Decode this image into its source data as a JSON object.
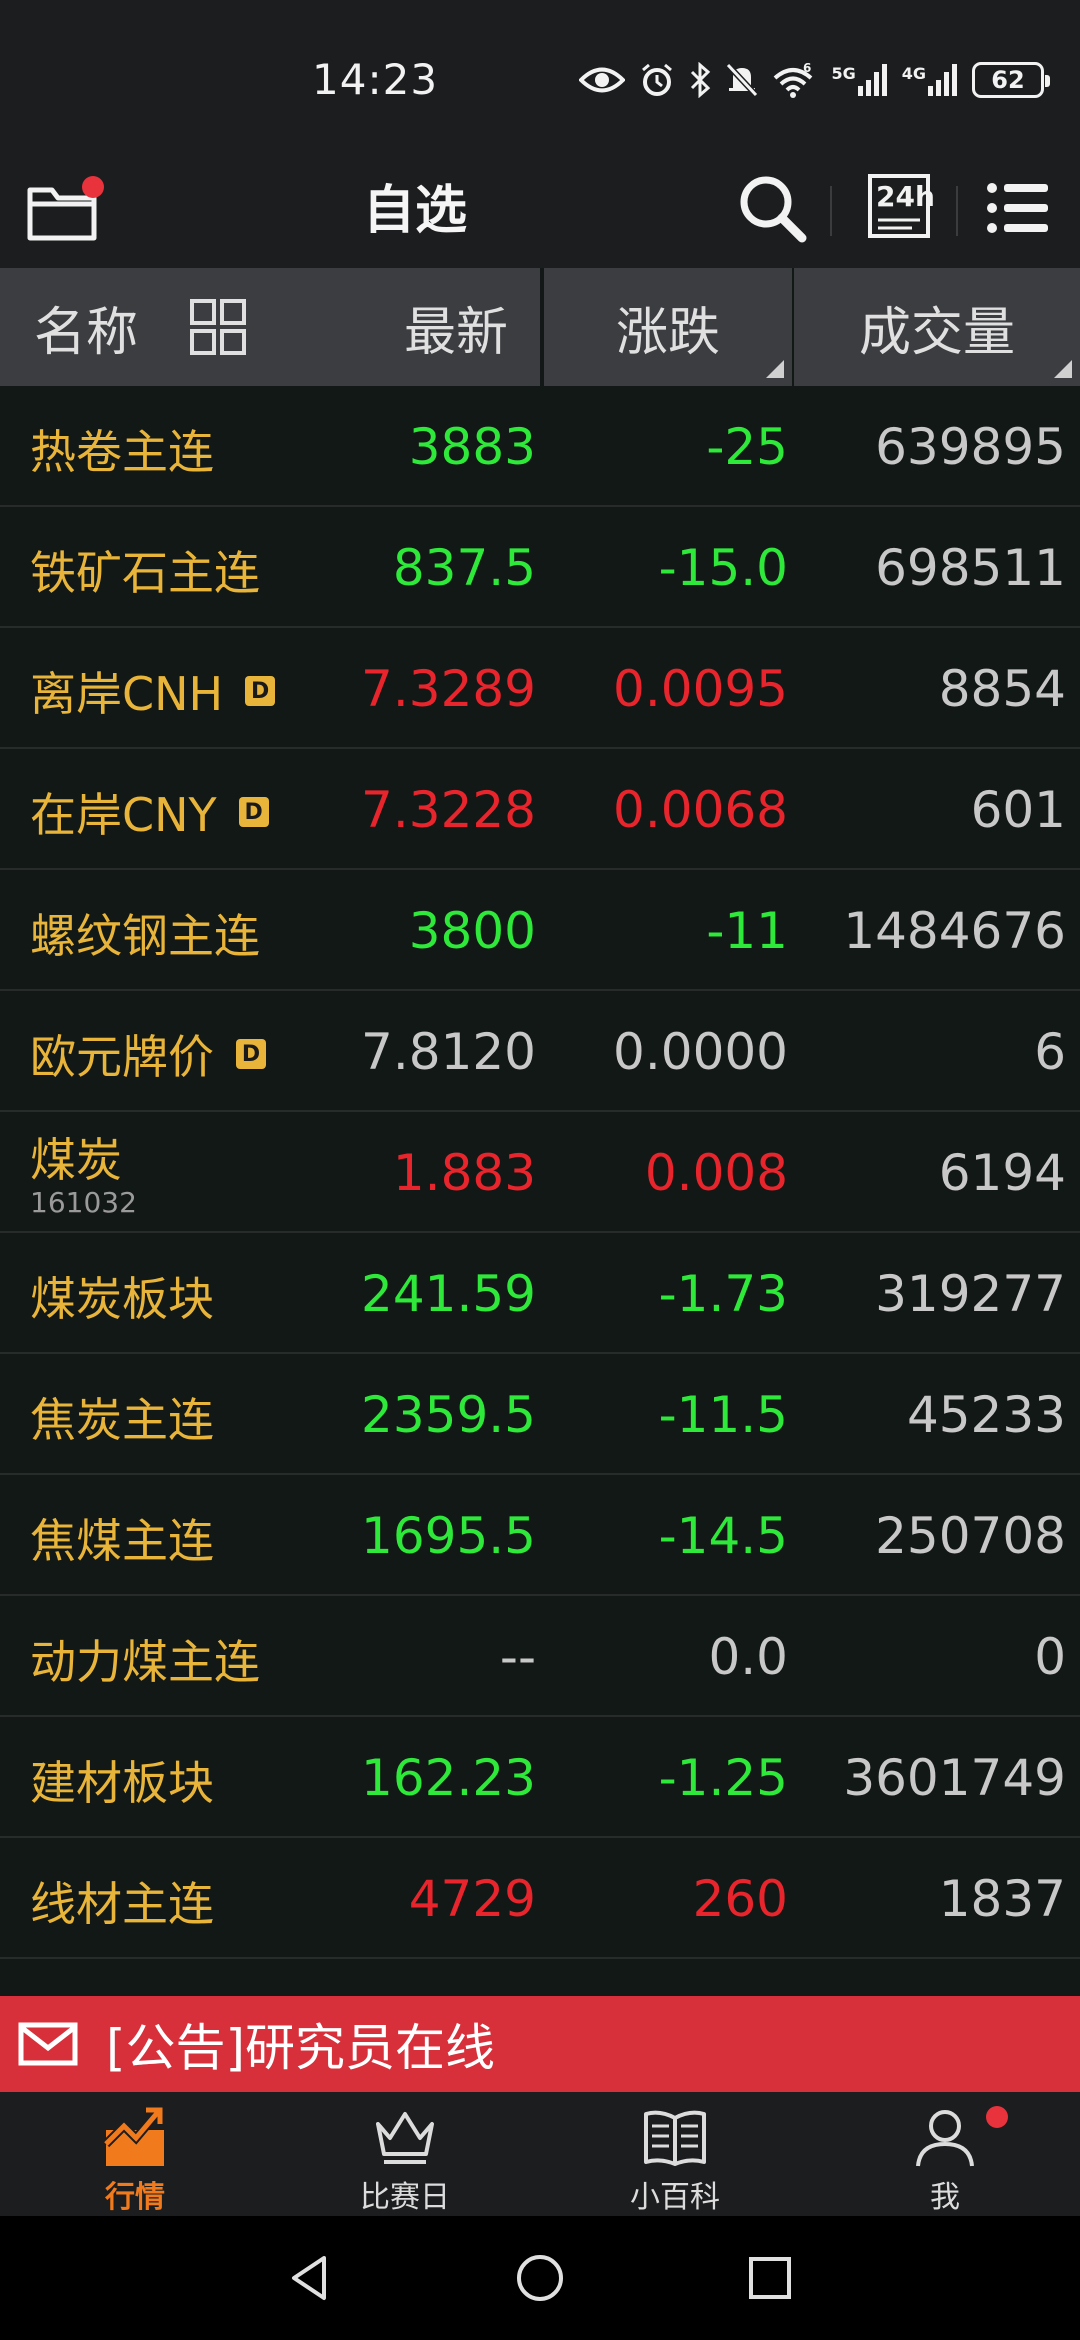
{
  "status_bar": {
    "time": "14:23",
    "signal_5g": "5G",
    "signal_4g": "4G",
    "battery": "62",
    "icons": [
      "eye-icon",
      "alarm-icon",
      "bluetooth-icon",
      "mute-icon",
      "wifi-icon",
      "signal-icon",
      "battery-icon"
    ]
  },
  "app_bar": {
    "title": "自选",
    "h24_label": "24h",
    "icons": [
      "folder-icon",
      "search-icon",
      "24h-icon",
      "list-menu-icon"
    ]
  },
  "columns": {
    "name": "名称",
    "latest": "最新",
    "change": "涨跌",
    "volume": "成交量"
  },
  "rows": [
    {
      "name": "热卷主连",
      "latest": "3883",
      "change": "-25",
      "volume": "639895",
      "color": "green"
    },
    {
      "name": "铁矿石主连",
      "latest": "837.5",
      "change": "-15.0",
      "volume": "698511",
      "color": "green"
    },
    {
      "name": "离岸CNH",
      "badge": "D",
      "latest": "7.3289",
      "change": "0.0095",
      "volume": "8854",
      "color": "red"
    },
    {
      "name": "在岸CNY",
      "badge": "D",
      "latest": "7.3228",
      "change": "0.0068",
      "volume": "601",
      "color": "red"
    },
    {
      "name": "螺纹钢主连",
      "latest": "3800",
      "change": "-11",
      "volume": "1484676",
      "color": "green"
    },
    {
      "name": "欧元牌价",
      "badge": "D",
      "latest": "7.8120",
      "change": "0.0000",
      "volume": "6",
      "color": "gray"
    },
    {
      "name": "煤炭",
      "code": "161032",
      "latest": "1.883",
      "change": "0.008",
      "volume": "6194",
      "color": "red"
    },
    {
      "name": "煤炭板块",
      "latest": "241.59",
      "change": "-1.73",
      "volume": "319277",
      "color": "green"
    },
    {
      "name": "焦炭主连",
      "latest": "2359.5",
      "change": "-11.5",
      "volume": "45233",
      "color": "green"
    },
    {
      "name": "焦煤主连",
      "latest": "1695.5",
      "change": "-14.5",
      "volume": "250708",
      "color": "green"
    },
    {
      "name": "动力煤主连",
      "latest": "--",
      "change": "0.0",
      "volume": "0",
      "color": "gray"
    },
    {
      "name": "建材板块",
      "latest": "162.23",
      "change": "-1.25",
      "volume": "3601749",
      "color": "green"
    },
    {
      "name": "线材主连",
      "latest": "4729",
      "change": "260",
      "volume": "1837",
      "color": "red"
    }
  ],
  "notice": {
    "text": "[公告]研究员在线"
  },
  "bottom_nav": {
    "items": [
      {
        "label": "行情",
        "active": true
      },
      {
        "label": "比赛日",
        "active": false
      },
      {
        "label": "小百科",
        "active": false
      },
      {
        "label": "我",
        "active": false
      }
    ]
  },
  "colors": {
    "accent": "#f07a1c",
    "up": "#e8242c",
    "down": "#2ee83a",
    "name": "#e8b43a",
    "notice_bg": "#d8303a"
  }
}
